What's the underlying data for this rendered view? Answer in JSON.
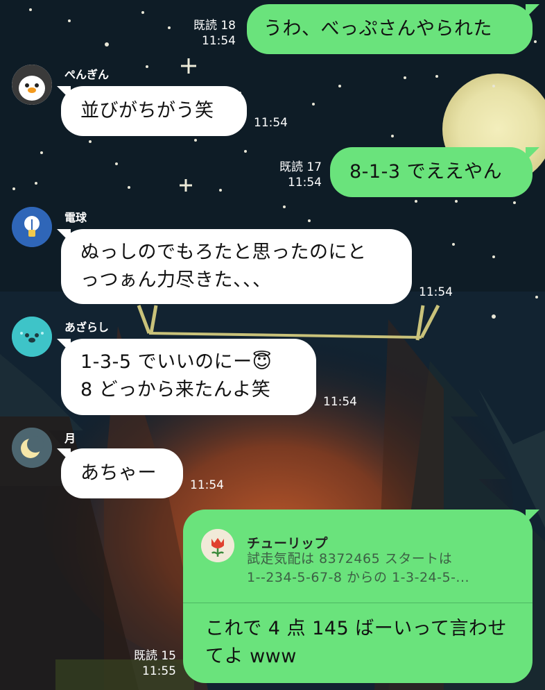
{
  "messages": [
    {
      "id": "m1",
      "side": "out",
      "text": "うわ、べっぷさんやられた",
      "read": "既読 18",
      "time": "11:54"
    },
    {
      "id": "m2",
      "side": "in",
      "sender": "ぺんぎん",
      "avatar": "penguin-icon",
      "text": "並びがちがう笑",
      "time": "11:54"
    },
    {
      "id": "m3",
      "side": "out",
      "text": "8-1-3 でええやん",
      "read": "既読 17",
      "time": "11:54"
    },
    {
      "id": "m4",
      "side": "in",
      "sender": "電球",
      "avatar": "lightbulb-icon",
      "lines": [
        "ぬっしのでもろたと思ったのにと",
        "っつぁん力尽きた、、、"
      ],
      "time": "11:54"
    },
    {
      "id": "m5",
      "side": "in",
      "sender": "あざらし",
      "avatar": "seal-icon",
      "lines": [
        "1-3-5 でいいのにー😇",
        "8 どっから来たんよ笑"
      ],
      "time": "11:54"
    },
    {
      "id": "m6",
      "side": "in",
      "sender": "月",
      "avatar": "moon-icon",
      "text": "あちゃー",
      "time": "11:54"
    },
    {
      "id": "m7",
      "side": "out",
      "reply": {
        "sender": "チューリップ",
        "avatar": "tulip-icon",
        "lines": [
          "試走気配は 8372465 スタートは",
          "1--234-5-67-8 からの 1-3-24-5-..."
        ]
      },
      "lines": [
        "これで 4 点 145 ばーいって言わせ",
        "てよ www"
      ],
      "read": "既読 15",
      "time": "11:55"
    }
  ],
  "colors": {
    "outgoing": "#6ae37c",
    "incoming": "#ffffff",
    "background": "#0d1a24"
  }
}
